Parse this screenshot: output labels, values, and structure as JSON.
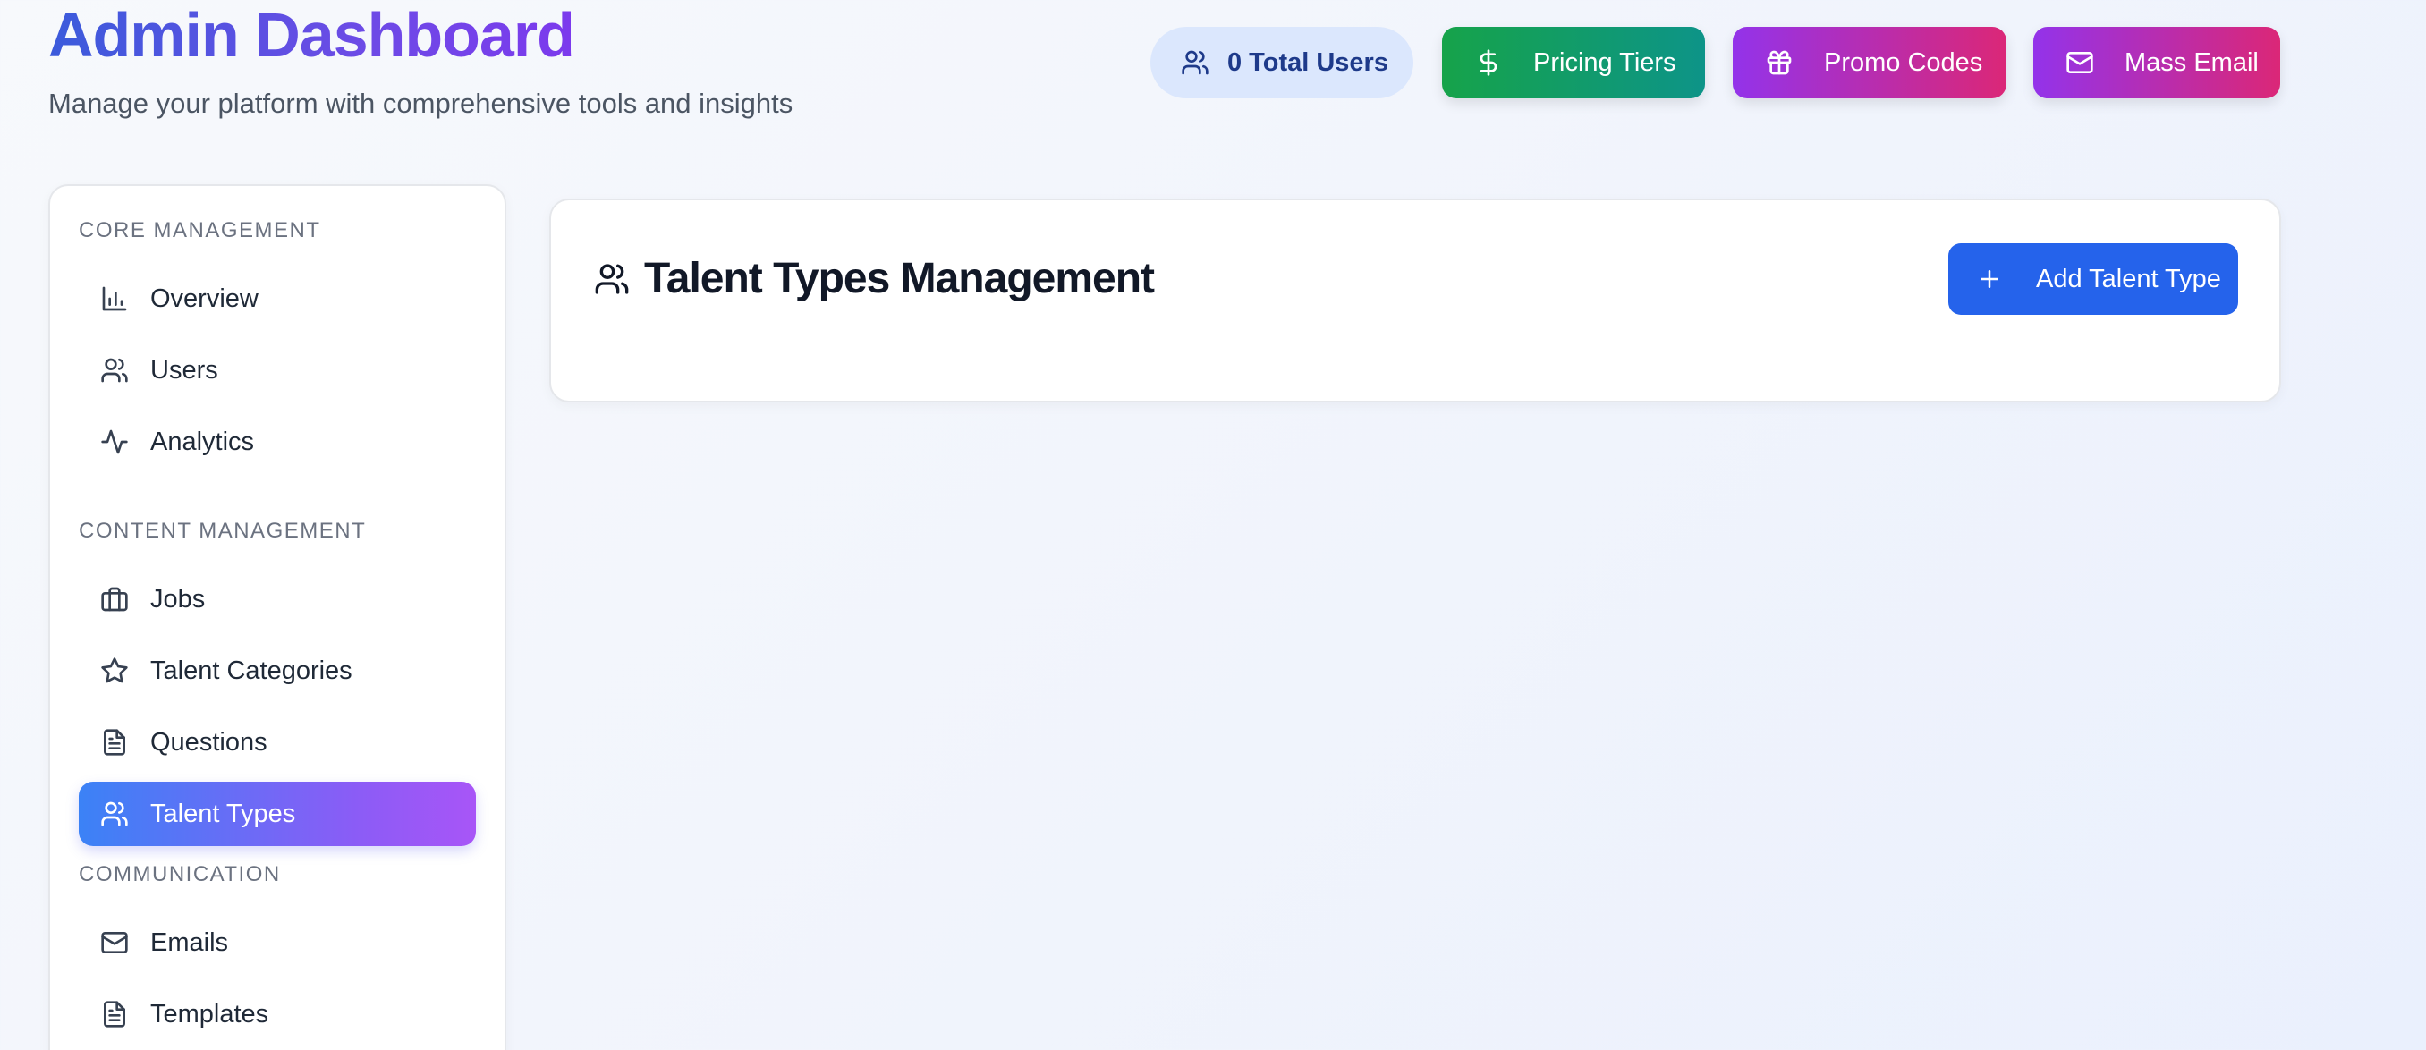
{
  "header": {
    "title": "Admin Dashboard",
    "subtitle": "Manage your platform with comprehensive tools and insights"
  },
  "top_actions": {
    "users_count_label": "0 Total Users",
    "pricing_label": "Pricing Tiers",
    "promo_label": "Promo Codes",
    "mass_email_label": "Mass Email",
    "icons": [
      "users-icon",
      "dollar-icon",
      "gift-icon",
      "mail-icon"
    ]
  },
  "sidebar": {
    "sections": [
      {
        "label": "CORE MANAGEMENT",
        "items": [
          {
            "label": "Overview",
            "icon": "bar-chart-icon"
          },
          {
            "label": "Users",
            "icon": "users-icon"
          },
          {
            "label": "Analytics",
            "icon": "activity-icon"
          }
        ]
      },
      {
        "label": "CONTENT MANAGEMENT",
        "items": [
          {
            "label": "Jobs",
            "icon": "briefcase-icon"
          },
          {
            "label": "Talent Categories",
            "icon": "star-icon"
          },
          {
            "label": "Questions",
            "icon": "file-text-icon"
          },
          {
            "label": "Talent Types",
            "icon": "users-icon",
            "active": true
          }
        ]
      },
      {
        "label": "COMMUNICATION",
        "items": [
          {
            "label": "Emails",
            "icon": "mail-icon"
          },
          {
            "label": "Templates",
            "icon": "file-text-icon"
          }
        ]
      }
    ]
  },
  "main": {
    "title": "Talent Types Management",
    "add_button_label": "Add Talent Type"
  },
  "colors": {
    "accent_blue": "#2563eb",
    "pricing_gradient": [
      "#16a34a",
      "#0d9488"
    ],
    "promo_gradient": [
      "#9333ea",
      "#db2777"
    ],
    "active_nav_gradient": [
      "#3b82f6",
      "#a855f7"
    ],
    "users_pill_bg": "#dbe7fd"
  }
}
